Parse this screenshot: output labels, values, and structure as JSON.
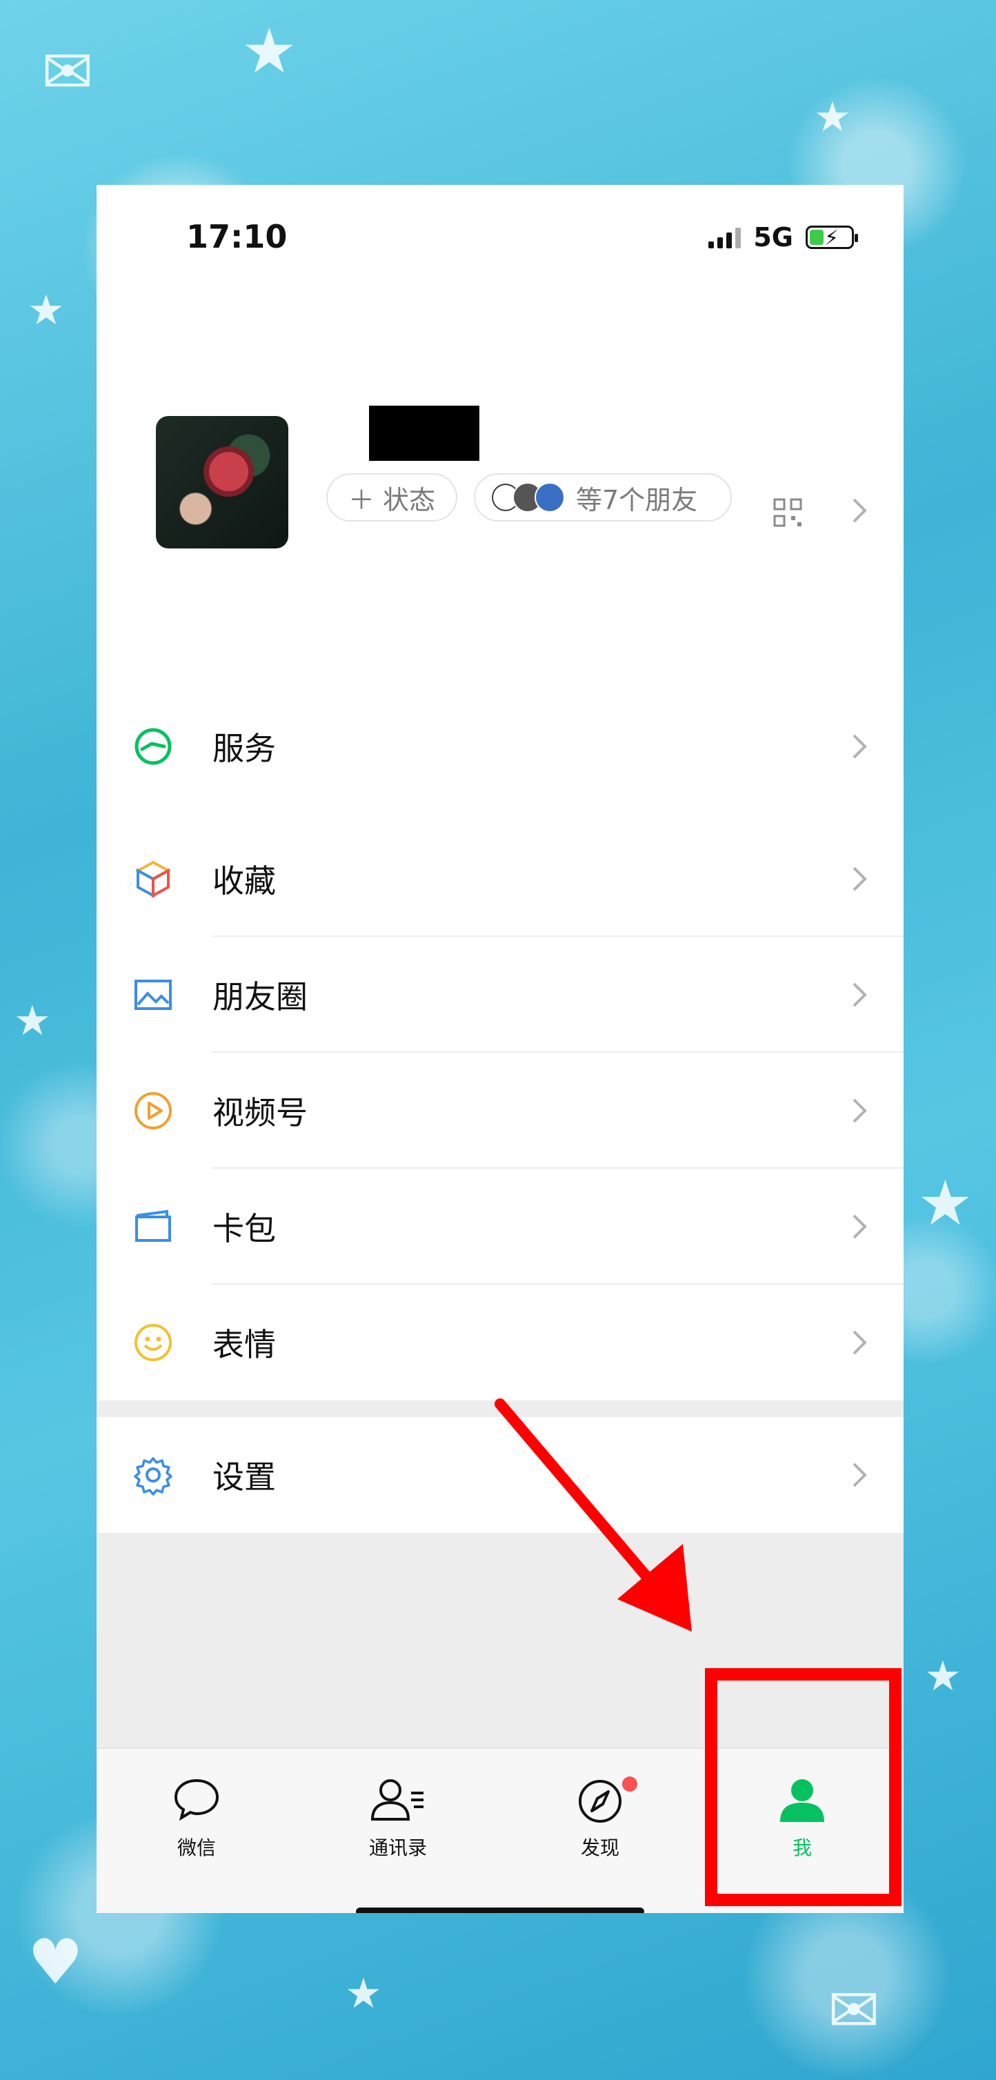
{
  "status_bar": {
    "time": "17:10",
    "network": "5G"
  },
  "profile": {
    "status_button": "＋ 状态",
    "friends_pill": "等7个朋友"
  },
  "menu": {
    "services": "服务",
    "favorites": "收藏",
    "moments": "朋友圈",
    "channels": "视频号",
    "cards": "卡包",
    "stickers": "表情",
    "settings": "设置"
  },
  "tabbar": {
    "chats": "微信",
    "contacts": "通讯录",
    "discover": "发现",
    "me": "我",
    "active_tab": "me"
  },
  "colors": {
    "accent_green": "#07c160",
    "annotation_red": "#ff0000",
    "badge_red": "#fa5151"
  },
  "annotation": {
    "highlight_target": "me"
  }
}
